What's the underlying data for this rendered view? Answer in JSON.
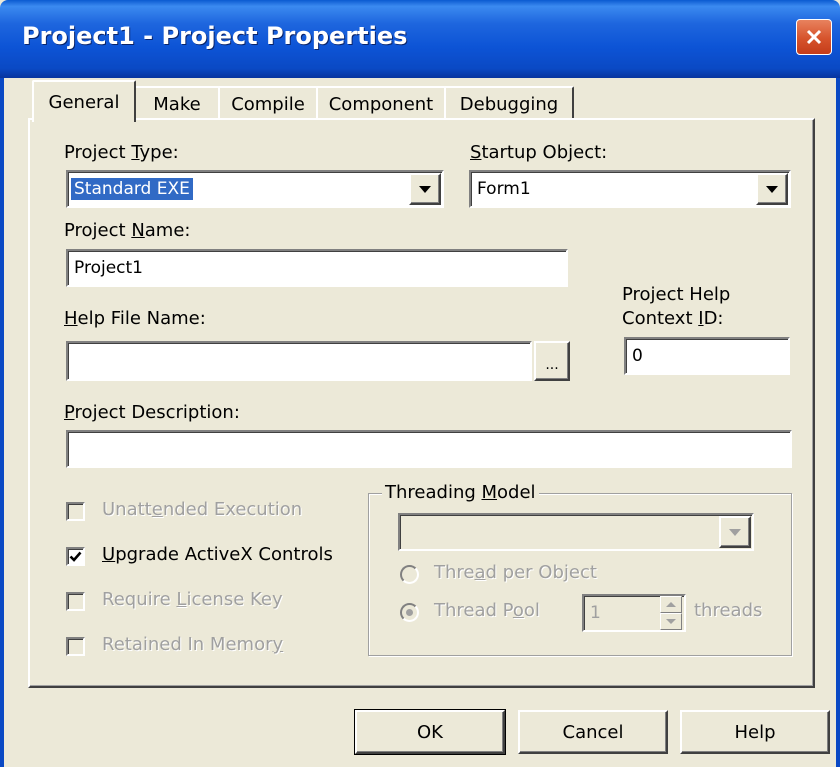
{
  "window": {
    "title": "Project1 - Project Properties"
  },
  "tabs": [
    {
      "label": "General",
      "active": true
    },
    {
      "label": "Make"
    },
    {
      "label": "Compile"
    },
    {
      "label": "Component"
    },
    {
      "label": "Debugging"
    }
  ],
  "general": {
    "project_type": {
      "label_pre": "Project ",
      "label_u": "T",
      "label_post": "ype:",
      "value": "Standard EXE"
    },
    "startup_object": {
      "label_pre": "",
      "label_u": "S",
      "label_post": "tartup Object:",
      "value": "Form1"
    },
    "project_name": {
      "label_pre": "Project ",
      "label_u": "N",
      "label_post": "ame:",
      "value": "Project1"
    },
    "help_file": {
      "label_pre": "",
      "label_u": "H",
      "label_post": "elp File Name:",
      "value": "",
      "browse_label": "..."
    },
    "help_context": {
      "label_line1": "Project Help",
      "label_pre": "Context ",
      "label_u": "I",
      "label_post": "D:",
      "value": "0"
    },
    "description": {
      "label_pre": "",
      "label_u": "P",
      "label_post": "roject Description:",
      "value": ""
    },
    "options": [
      {
        "pre": "Unatt",
        "u": "e",
        "post": "nded Execution",
        "checked": false,
        "enabled": false
      },
      {
        "pre": "",
        "u": "U",
        "post": "pgrade ActiveX Controls",
        "checked": true,
        "enabled": true
      },
      {
        "pre": "Require ",
        "u": "L",
        "post": "icense Key",
        "checked": false,
        "enabled": false
      },
      {
        "pre": "Retained In Memor",
        "u": "y",
        "post": "",
        "checked": false,
        "enabled": false
      }
    ],
    "threading": {
      "legend_pre": "Threading ",
      "legend_u": "M",
      "legend_post": "odel",
      "model_value": "",
      "per_object": {
        "pre": "Thre",
        "u": "a",
        "post": "d per Object"
      },
      "pool": {
        "pre": "Thread P",
        "u": "o",
        "post": "ol"
      },
      "pool_count": "1",
      "threads_label": "threads"
    }
  },
  "buttons": {
    "ok": "OK",
    "cancel": "Cancel",
    "help": "Help"
  }
}
